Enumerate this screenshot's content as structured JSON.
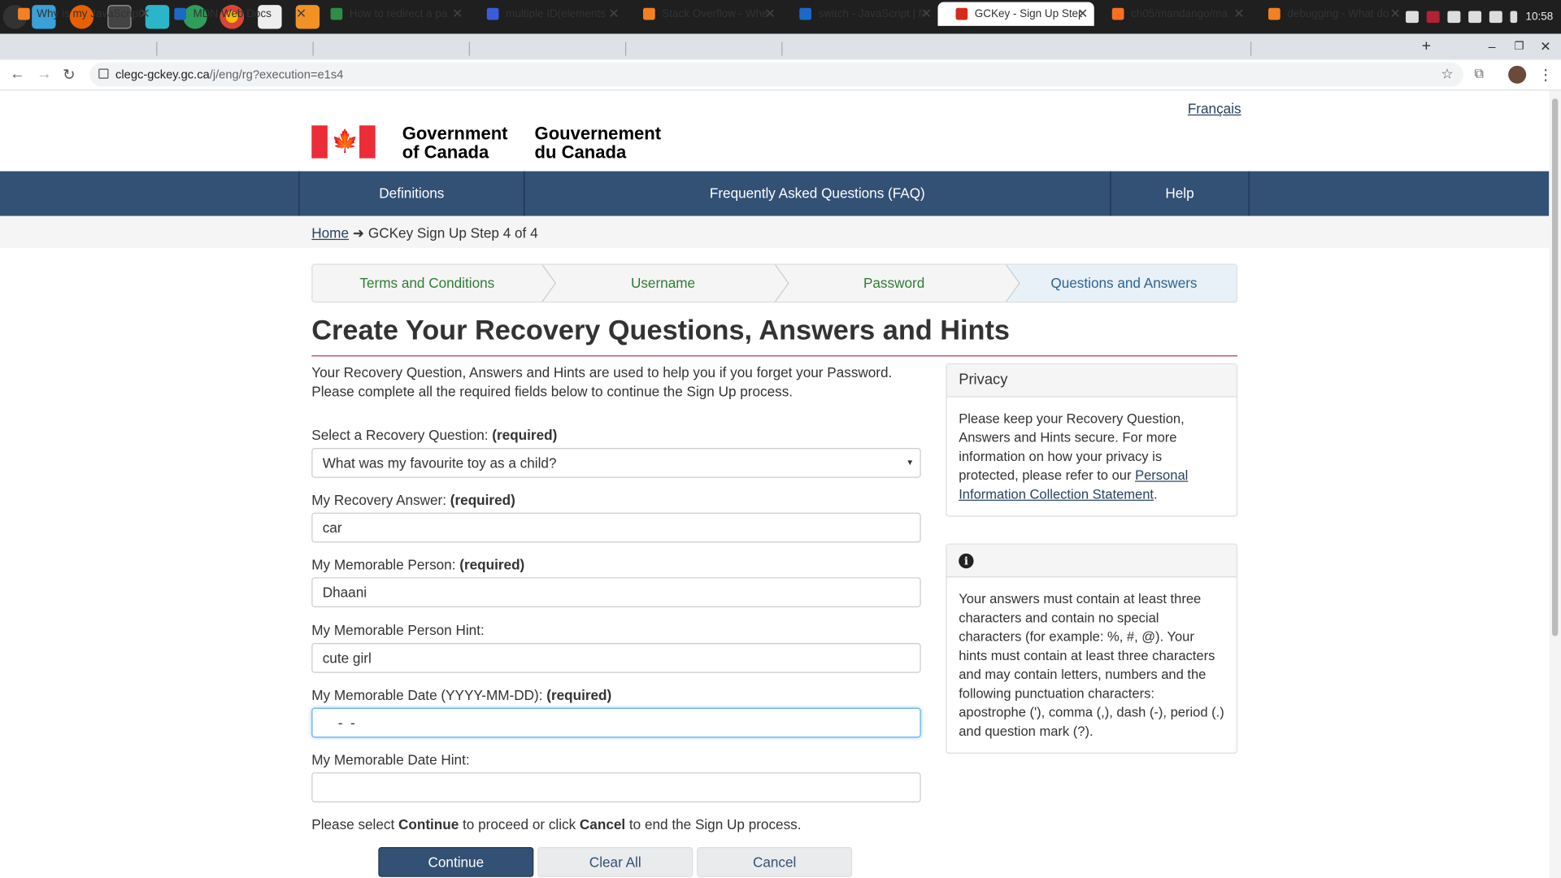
{
  "taskbar": {
    "clock": "10:58"
  },
  "browser": {
    "tabs": [
      {
        "title": "Why is my JavaScript",
        "icon": "stackoverflow-icon",
        "active": false
      },
      {
        "title": "MDN Web Docs",
        "icon": "mdn-icon",
        "active": false
      },
      {
        "title": "How to redirect a pa",
        "icon": "gfg-icon",
        "active": false
      },
      {
        "title": "multiple ID(elements",
        "icon": "d-icon",
        "active": false
      },
      {
        "title": "Stack Overflow - Whe",
        "icon": "stackoverflow-icon",
        "active": false
      },
      {
        "title": "switch - JavaScript | M",
        "icon": "mdn-icon",
        "active": false
      },
      {
        "title": "GCKey - Sign Up Step",
        "icon": "maple-leaf-icon",
        "active": true
      },
      {
        "title": "ch05/mandango/ma",
        "icon": "gitlab-icon",
        "active": false
      },
      {
        "title": "debugging - What do",
        "icon": "stackoverflow-icon",
        "active": false
      }
    ],
    "url_host": "clegc-gckey.gc.ca",
    "url_path": "/j/eng/rg?execution=e1s4"
  },
  "header": {
    "language_link": "Français",
    "gov_en_line1": "Government",
    "gov_en_line2": "of Canada",
    "gov_fr_line1": "Gouvernement",
    "gov_fr_line2": "du Canada"
  },
  "nav": {
    "definitions": "Definitions",
    "faq": "Frequently Asked Questions (FAQ)",
    "help": "Help"
  },
  "breadcrumb": {
    "home": "Home",
    "arrow": "➜",
    "current": "GCKey Sign Up Step 4 of 4"
  },
  "steps": [
    "Terms and Conditions",
    "Username",
    "Password",
    "Questions and Answers"
  ],
  "page_title": "Create Your Recovery Questions, Answers and Hints",
  "intro": "Your Recovery Question, Answers and Hints are used to help you if you forget your Password. Please complete all the required fields below to continue the Sign Up process.",
  "required_tag": "(required)",
  "form": {
    "question_label": "Select a Recovery Question:",
    "question_value": "What was my favourite toy as a child?",
    "answer_label": "My Recovery Answer:",
    "answer_value": "car",
    "person_label": "My Memorable Person:",
    "person_value": "Dhaani",
    "person_hint_label": "My Memorable Person Hint:",
    "person_hint_value": "cute girl",
    "date_label": "My Memorable Date (YYYY-MM-DD):",
    "date_value": "    -  -",
    "date_hint_label": "My Memorable Date Hint:",
    "date_hint_value": ""
  },
  "instructions": {
    "part1": "Please select ",
    "continue": "Continue",
    "part2": " to proceed or click ",
    "cancel": "Cancel",
    "part3": " to end the Sign Up process."
  },
  "buttons": {
    "continue": "Continue",
    "clear": "Clear All",
    "cancel": "Cancel"
  },
  "privacy_panel": {
    "title": "Privacy",
    "text": "Please keep your Recovery Question, Answers and Hints secure. For more information on how your privacy is protected, please refer to our ",
    "link": "Personal Information Collection Statement",
    "after": "."
  },
  "info_panel": {
    "icon": "info-icon",
    "text": "Your answers must contain at least three characters and contain no special characters (for example: %, #, @). Your hints must contain at least three characters and may contain letters, numbers and the following punctuation characters: apostrophe ('), comma (,), dash (-), period (.) and question mark (?)."
  },
  "colors": {
    "nav": "#335075",
    "primary_button": "#335075",
    "title_rule": "#af3c43",
    "flag_red": "#eb2d37"
  }
}
